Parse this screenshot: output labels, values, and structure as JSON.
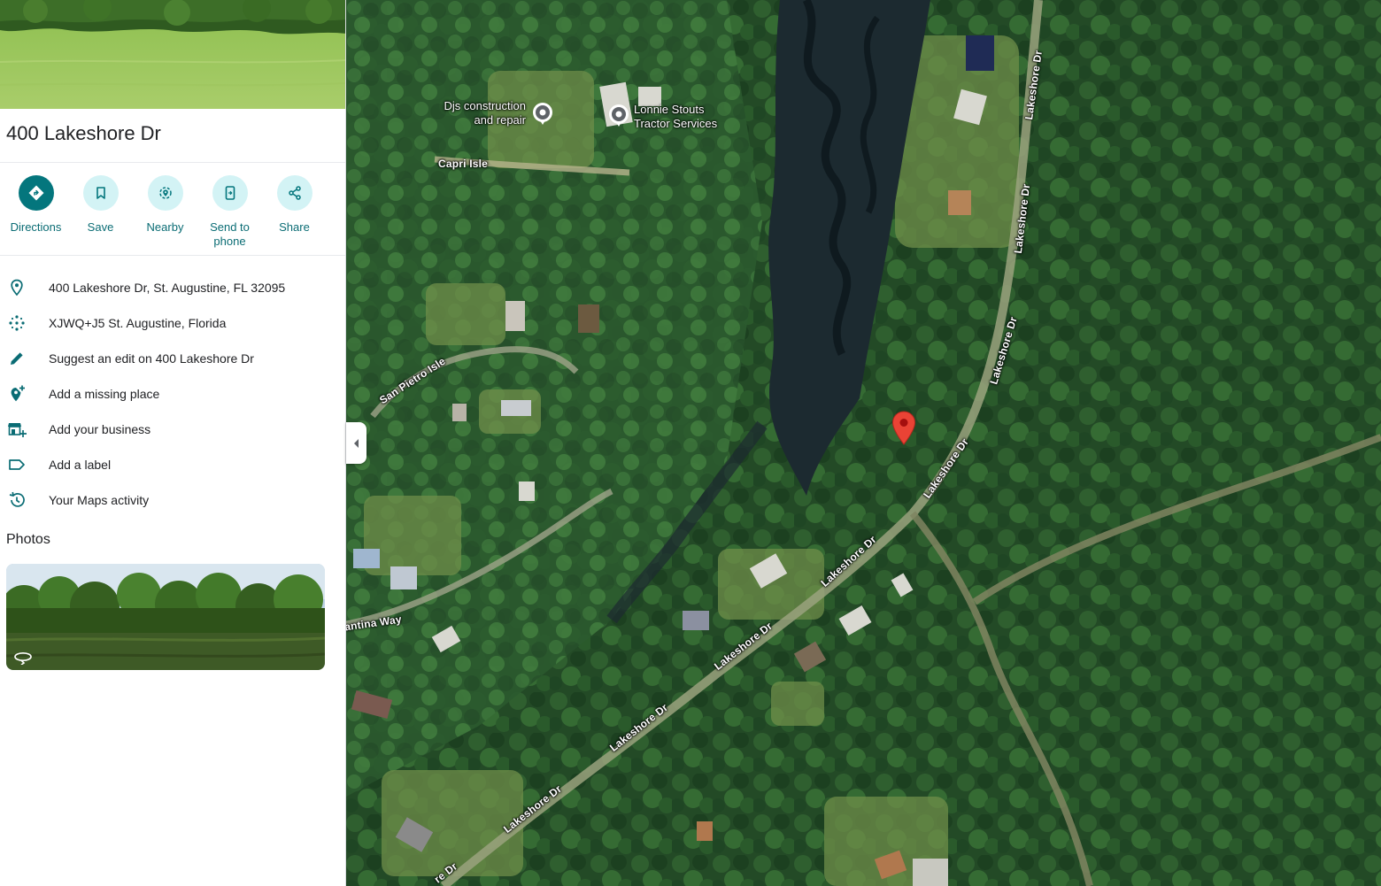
{
  "place": {
    "title": "400 Lakeshore Dr"
  },
  "actions": [
    {
      "label": "Directions",
      "icon": "directions-icon"
    },
    {
      "label": "Save",
      "icon": "bookmark-icon"
    },
    {
      "label": "Nearby",
      "icon": "nearby-icon"
    },
    {
      "label": "Send to phone",
      "icon": "send-to-phone-icon"
    },
    {
      "label": "Share",
      "icon": "share-icon"
    }
  ],
  "info": [
    {
      "text": "400 Lakeshore Dr, St. Augustine, FL 32095",
      "icon": "location-pin-icon"
    },
    {
      "text": "XJWQ+J5 St. Augustine, Florida",
      "icon": "plus-code-icon"
    },
    {
      "text": "Suggest an edit on 400 Lakeshore Dr",
      "icon": "pencil-icon"
    },
    {
      "text": "Add a missing place",
      "icon": "add-place-icon"
    },
    {
      "text": "Add your business",
      "icon": "add-business-icon"
    },
    {
      "text": "Add a label",
      "icon": "label-icon"
    },
    {
      "text": "Your Maps activity",
      "icon": "history-icon"
    }
  ],
  "photos": {
    "title": "Photos"
  },
  "map": {
    "pois": [
      {
        "name": "Djs construction and repair",
        "line1": "Djs construction",
        "line2": "and repair"
      },
      {
        "name": "Lonnie Stouts Tractor Services",
        "line1": "Lonnie Stouts",
        "line2": "Tractor Services"
      }
    ],
    "roads": {
      "capri_isle": "Capri Isle",
      "san_pietro_isle": "San Pietro Isle",
      "cantina_way": "antina Way",
      "lakeshore_1": "Lakeshore Dr",
      "lakeshore_2": "Lakeshore Dr",
      "lakeshore_3": "Lakeshore Dr",
      "lakeshore_4": "Lakeshore Dr",
      "lakeshore_5": "Lakeshore Dr",
      "lakeshore_6": "Lakeshore Dr",
      "lakeshore_7": "Lakeshore Dr",
      "lakeshore_8": "Lakeshore Dr",
      "lakeshore_9": "Lakeshore Dr",
      "lakeshore_10": "re Dr"
    }
  },
  "colors": {
    "accent": "#04767d",
    "accent_light": "#d3f3f5",
    "pin": "#ea4335"
  }
}
